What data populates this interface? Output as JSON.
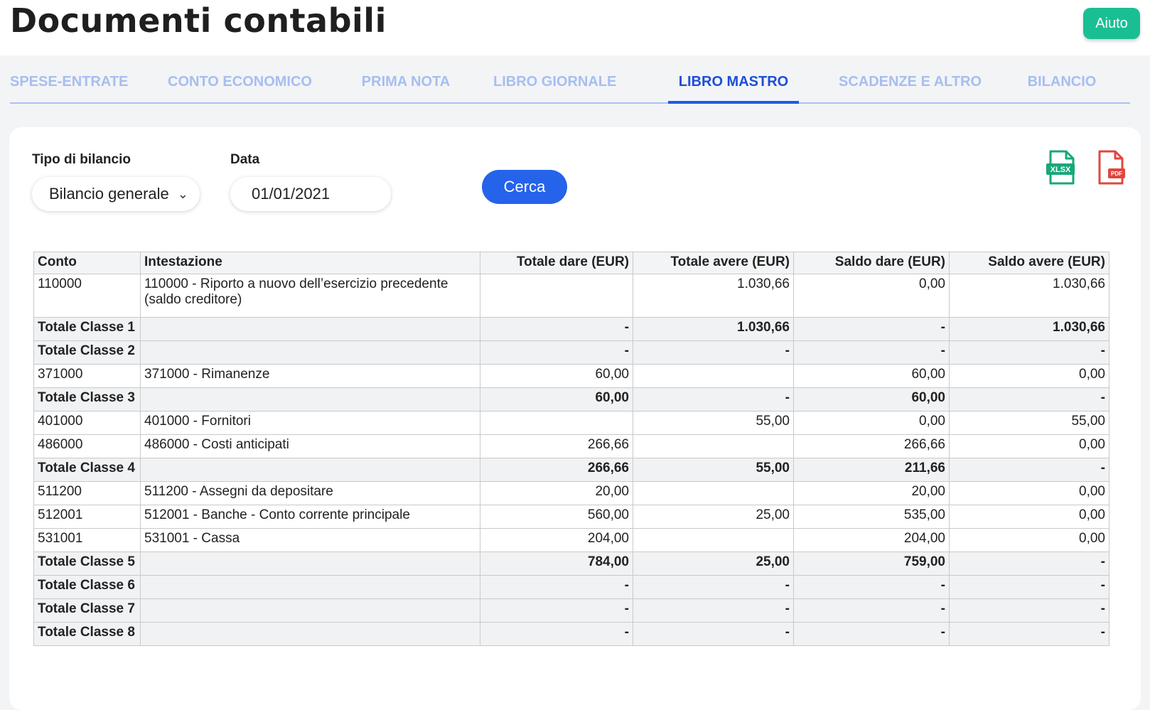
{
  "header": {
    "title": "Documenti contabili",
    "help_label": "Aiuto"
  },
  "tabs": [
    "SPESE-ENTRATE",
    "CONTO ECONOMICO",
    "PRIMA NOTA",
    "LIBRO GIORNALE",
    "LIBRO MASTRO",
    "SCADENZE E ALTRO",
    "BILANCIO"
  ],
  "active_tab": "LIBRO MASTRO",
  "filters": {
    "tipo_label": "Tipo di bilancio",
    "tipo_value": "Bilancio generale",
    "data_label": "Data",
    "data_value": "01/01/2021",
    "search_label": "Cerca"
  },
  "export": {
    "xlsx": "XLSX",
    "pdf": "PDF"
  },
  "table": {
    "headers": [
      "Conto",
      "Intestazione",
      "Totale dare (EUR)",
      "Totale avere (EUR)",
      "Saldo dare (EUR)",
      "Saldo avere (EUR)"
    ],
    "rows": [
      {
        "conto": "110000",
        "intestazione": "110000 - Riporto a nuovo dell’esercizio precedente (saldo creditore)",
        "tdare": "",
        "tavere": "1.030,66",
        "sdare": "0,00",
        "savere": "1.030,66"
      },
      {
        "conto": "Totale Classe 1",
        "intestazione": "",
        "tdare": "-",
        "tavere": "1.030,66",
        "sdare": "-",
        "savere": "1.030,66"
      },
      {
        "conto": "Totale Classe 2",
        "intestazione": "",
        "tdare": "-",
        "tavere": "-",
        "sdare": "-",
        "savere": "-"
      },
      {
        "conto": "371000",
        "intestazione": "371000 - Rimanenze",
        "tdare": "60,00",
        "tavere": "",
        "sdare": "60,00",
        "savere": "0,00"
      },
      {
        "conto": "Totale Classe 3",
        "intestazione": "",
        "tdare": "60,00",
        "tavere": "-",
        "sdare": "60,00",
        "savere": "-"
      },
      {
        "conto": "401000",
        "intestazione": "401000 - Fornitori",
        "tdare": "",
        "tavere": "55,00",
        "sdare": "0,00",
        "savere": "55,00"
      },
      {
        "conto": "486000",
        "intestazione": "486000 - Costi anticipati",
        "tdare": "266,66",
        "tavere": "",
        "sdare": "266,66",
        "savere": "0,00"
      },
      {
        "conto": "Totale Classe 4",
        "intestazione": "",
        "tdare": "266,66",
        "tavere": "55,00",
        "sdare": "211,66",
        "savere": "-"
      },
      {
        "conto": "511200",
        "intestazione": "511200 - Assegni da depositare",
        "tdare": "20,00",
        "tavere": "",
        "sdare": "20,00",
        "savere": "0,00"
      },
      {
        "conto": "512001",
        "intestazione": "512001 - Banche - Conto corrente principale",
        "tdare": "560,00",
        "tavere": "25,00",
        "sdare": "535,00",
        "savere": "0,00"
      },
      {
        "conto": "531001",
        "intestazione": "531001 - Cassa",
        "tdare": "204,00",
        "tavere": "",
        "sdare": "204,00",
        "savere": "0,00"
      },
      {
        "conto": "Totale Classe 5",
        "intestazione": "",
        "tdare": "784,00",
        "tavere": "25,00",
        "sdare": "759,00",
        "savere": "-"
      },
      {
        "conto": "Totale Classe 6",
        "intestazione": "",
        "tdare": "-",
        "tavere": "-",
        "sdare": "-",
        "savere": "-"
      },
      {
        "conto": "Totale Classe 7",
        "intestazione": "",
        "tdare": "-",
        "tavere": "-",
        "sdare": "-",
        "savere": "-"
      },
      {
        "conto": "Totale Classe 8",
        "intestazione": "",
        "tdare": "-",
        "tavere": "-",
        "sdare": "-",
        "savere": "-"
      }
    ]
  },
  "colors": {
    "accent": "#2563eb",
    "help": "#19bf92",
    "xlsx": "#17a879",
    "pdf": "#e0473e"
  }
}
